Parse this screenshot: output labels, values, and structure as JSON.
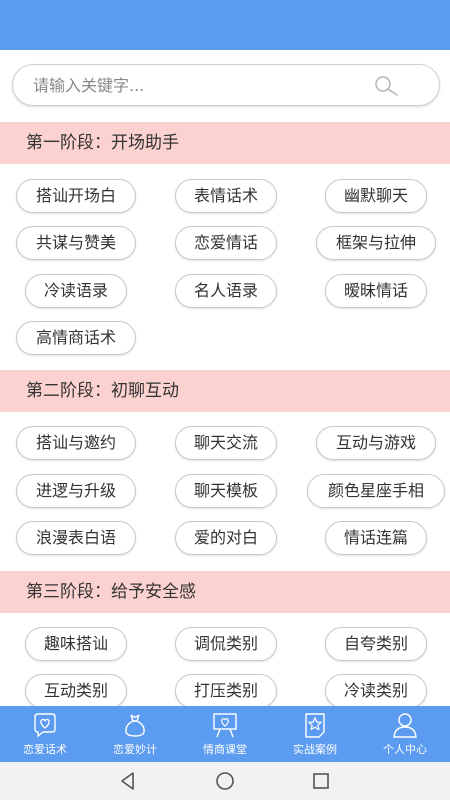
{
  "search": {
    "placeholder": "请输入关键字..."
  },
  "sections": [
    {
      "title": "第一阶段：开场助手",
      "tags": [
        "搭讪开场白",
        "表情话术",
        "幽默聊天",
        "共谋与赞美",
        "恋爱情话",
        "框架与拉伸",
        "冷读语录",
        "名人语录",
        "暧昧情话",
        "高情商话术"
      ]
    },
    {
      "title": "第二阶段：初聊互动",
      "tags": [
        "搭讪与邀约",
        "聊天交流",
        "互动与游戏",
        "进逻与升级",
        "聊天模板",
        "颜色星座手相",
        "浪漫表白语",
        "爱的对白",
        "情话连篇"
      ]
    },
    {
      "title": "第三阶段：给予安全感",
      "tags": [
        "趣味搭讪",
        "调侃类别",
        "自夸类别",
        "互动类别",
        "打压类别",
        "冷读类别"
      ]
    }
  ],
  "bottom_nav": [
    {
      "label": "恋爱话术",
      "icon": "heart-chat-icon"
    },
    {
      "label": "恋爱妙计",
      "icon": "bag-icon"
    },
    {
      "label": "情商课堂",
      "icon": "classroom-board-icon"
    },
    {
      "label": "实战案例",
      "icon": "star-card-icon"
    },
    {
      "label": "个人中心",
      "icon": "user-icon"
    }
  ],
  "colors": {
    "primary": "#5b9bf0",
    "section_bg": "#fbd2cf",
    "tag_border": "#c8c8c8"
  }
}
